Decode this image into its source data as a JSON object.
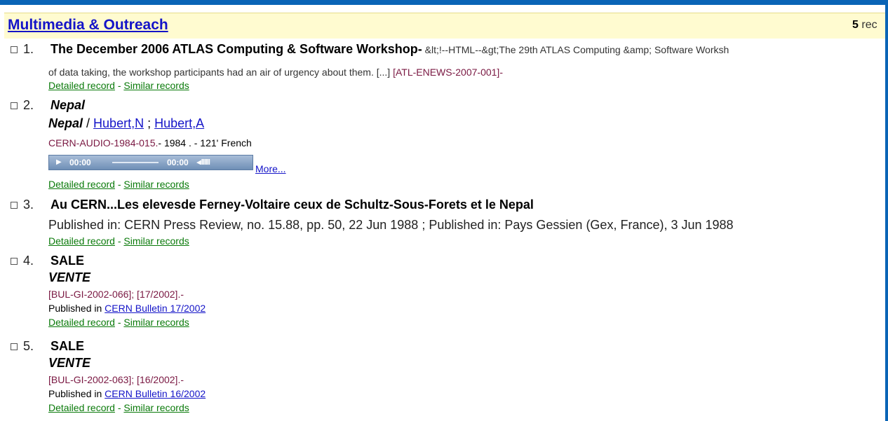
{
  "collection": {
    "title": "Multimedia & Outreach",
    "count": "5",
    "count_suffix": "rec"
  },
  "actions": {
    "detailed": "Detailed record",
    "dash": "-",
    "similar": "Similar records"
  },
  "records": [
    {
      "num": "1.",
      "title": "The December 2006 ATLAS Computing & Software Workshop-",
      "title_rest": " &lt;!--HTML--&gt;The 29th ATLAS Computing &amp; Software Worksh",
      "line2": "of data taking, the workshop participants had an air of urgency about them. [...] ",
      "ref": "[ATL-ENEWS-2007-001]-"
    },
    {
      "num": "2.",
      "title": "Nepal",
      "subtitle": "Nepal",
      "slash": " / ",
      "author1": "Hubert,N",
      "semi": " ; ",
      "author2": "Hubert,A",
      "ref": "CERN-AUDIO-1984-015.",
      "meta": "- 1984 . - 121' French",
      "player": {
        "time_elapsed": "00:00",
        "time_total": "00:00"
      },
      "more": "More..."
    },
    {
      "num": "3.",
      "title": "Au CERN...Les elevesde Ferney-Voltaire ceux de Schultz-Sous-Forets et le Nepal",
      "published": "Published in: CERN Press Review, no. 15.88, pp. 50, 22 Jun 1988 ; Published in: Pays Gessien (Gex, France), 3 Jun 1988"
    },
    {
      "num": "4.",
      "title": "SALE",
      "subtitle": "VENTE",
      "ref": "[BUL-GI-2002-066]; [17/2002].-",
      "pub_prefix": "Published in ",
      "pub_link": "CERN Bulletin 17/2002"
    },
    {
      "num": "5.",
      "title": "SALE",
      "subtitle": "VENTE",
      "ref": "[BUL-GI-2002-063]; [16/2002].-",
      "pub_prefix": "Published in ",
      "pub_link": "CERN Bulletin 16/2002"
    }
  ]
}
